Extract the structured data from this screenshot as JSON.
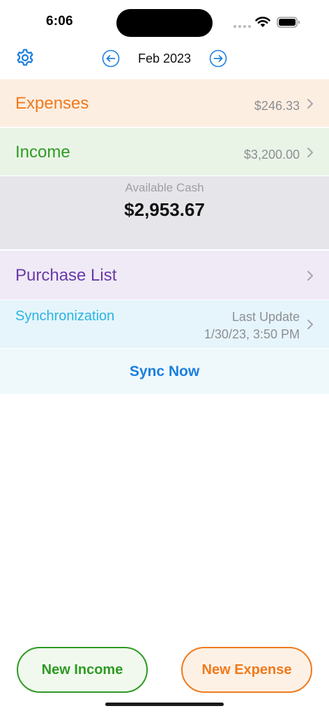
{
  "status_bar": {
    "time": "6:06"
  },
  "header": {
    "month": "Feb 2023",
    "settings_icon": "gear-icon",
    "prev_icon": "arrow-left-circle-icon",
    "next_icon": "arrow-right-circle-icon",
    "accent_color": "#1c7fe0"
  },
  "expenses": {
    "label": "Expenses",
    "value": "$246.33",
    "color": "#f07a1c",
    "background": "#fdeee2"
  },
  "income": {
    "label": "Income",
    "value": "$3,200.00",
    "color": "#2f9a24",
    "background": "#e9f4e7"
  },
  "cash": {
    "label": "Available Cash",
    "value": "$2,953.67"
  },
  "purchase_list": {
    "label": "Purchase List",
    "color": "#6a3aa6"
  },
  "sync": {
    "label": "Synchronization",
    "last_update_label": "Last Update",
    "last_update_time": "1/30/23, 3:50 PM",
    "color": "#2ab3e2",
    "sync_now_label": "Sync Now"
  },
  "bottom_buttons": {
    "new_income": "New Income",
    "new_expense": "New Expense"
  }
}
